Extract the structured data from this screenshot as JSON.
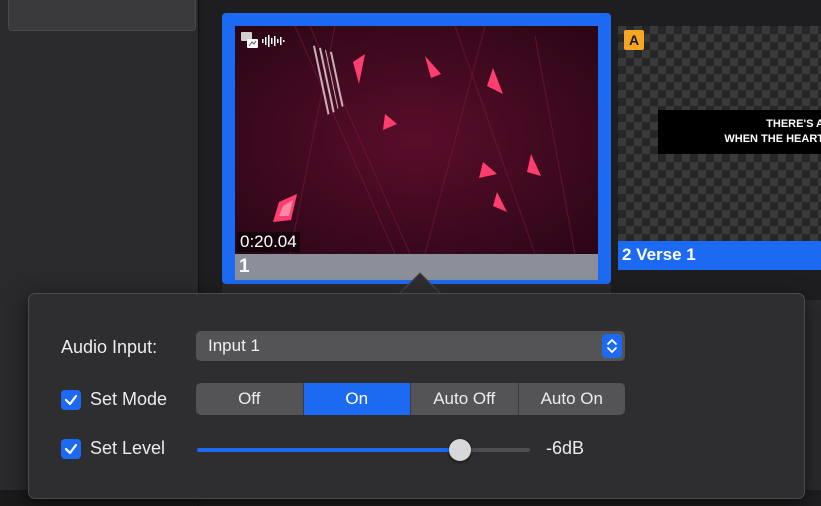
{
  "slides": [
    {
      "number": "1",
      "timecode": "0:20.04",
      "selected": true
    },
    {
      "label": "2 Verse 1",
      "badge": "A",
      "lyrics": [
        "THERE'S A",
        "WHEN THE HEART"
      ]
    }
  ],
  "popover": {
    "audio_input": {
      "label": "Audio Input:",
      "value": "Input 1"
    },
    "set_mode": {
      "label": "Set Mode",
      "checked": true,
      "options": [
        "Off",
        "On",
        "Auto Off",
        "Auto On"
      ],
      "selected": "On"
    },
    "set_level": {
      "label": "Set Level",
      "checked": true,
      "value_text": "-6dB",
      "level_fraction": 0.79
    }
  },
  "colors": {
    "accent": "#1d6af2",
    "badge": "#f5a623"
  },
  "icons": [
    "checkmark-icon",
    "stepper-chevrons-icon",
    "audio-waveform-icon",
    "media-type-icon"
  ]
}
